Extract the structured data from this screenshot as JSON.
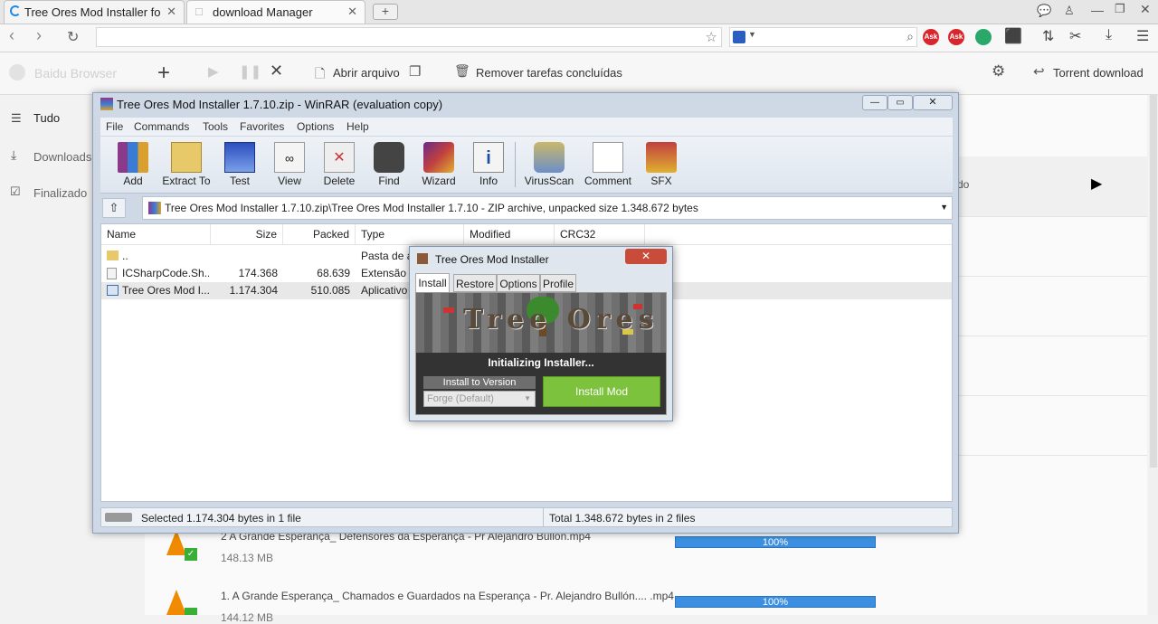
{
  "browser": {
    "tabs": [
      {
        "title": "Tree Ores Mod Installer for",
        "close": "✕"
      },
      {
        "title": "download Manager",
        "close": "✕"
      }
    ],
    "new_tab": "+",
    "brand": "Baidu Browser",
    "ext_labels": [
      "Ask",
      "Ask"
    ]
  },
  "download_manager": {
    "toolbar": {
      "open_file": "Abrir arquivo",
      "remove_done": "Remover tarefas concluídas",
      "torrent": "Torrent download"
    },
    "sidebar": [
      {
        "label": "Tudo"
      },
      {
        "label": "Downloads"
      },
      {
        "label": "Finalizado"
      }
    ],
    "partial_text": "do",
    "downloads": [
      {
        "name": "2 A Grande Esperança_ Defensores da Esperança - Pr Alejandro Bullon.mp4",
        "size": "148.13 MB",
        "progress": "100%"
      },
      {
        "name": "1. A Grande Esperança_ Chamados e Guardados na Esperança - Pr. Alejandro Bullón.... .mp4",
        "size": "144.12 MB",
        "progress": "100%"
      }
    ]
  },
  "winrar": {
    "title": "Tree Ores Mod Installer 1.7.10.zip - WinRAR (evaluation copy)",
    "menu": [
      "File",
      "Commands",
      "Tools",
      "Favorites",
      "Options",
      "Help"
    ],
    "toolbar": [
      "Add",
      "Extract To",
      "Test",
      "View",
      "Delete",
      "Find",
      "Wizard",
      "Info",
      "VirusScan",
      "Comment",
      "SFX"
    ],
    "path": "Tree Ores Mod Installer 1.7.10.zip\\Tree Ores Mod Installer 1.7.10 - ZIP archive, unpacked size 1.348.672 bytes",
    "columns": [
      "Name",
      "Size",
      "Packed",
      "Type",
      "Modified",
      "CRC32"
    ],
    "files": [
      {
        "name": "..",
        "size": "",
        "packed": "",
        "type": "Pasta de a"
      },
      {
        "name": "ICSharpCode.Sh...",
        "size": "174.368",
        "packed": "68.639",
        "type": "Extensão d"
      },
      {
        "name": "Tree Ores Mod I...",
        "size": "1.174.304",
        "packed": "510.085",
        "type": "Aplicativo"
      }
    ],
    "status_left": "Selected 1.174.304 bytes in 1 file",
    "status_right": "Total 1.348.672 bytes in 2 files"
  },
  "installer": {
    "title": "Tree Ores Mod Installer",
    "tabs": [
      "Install",
      "Restore",
      "Options",
      "Profile"
    ],
    "banner_text": "Tree Ores",
    "status": "Initializing Installer...",
    "version_label": "Install to Version",
    "version_value": "Forge (Default)",
    "install_button": "Install Mod"
  },
  "colors": {
    "progress": "#3c8fe0",
    "install_button": "#7cc23c",
    "winrar_frame": "#cfd9e6"
  }
}
